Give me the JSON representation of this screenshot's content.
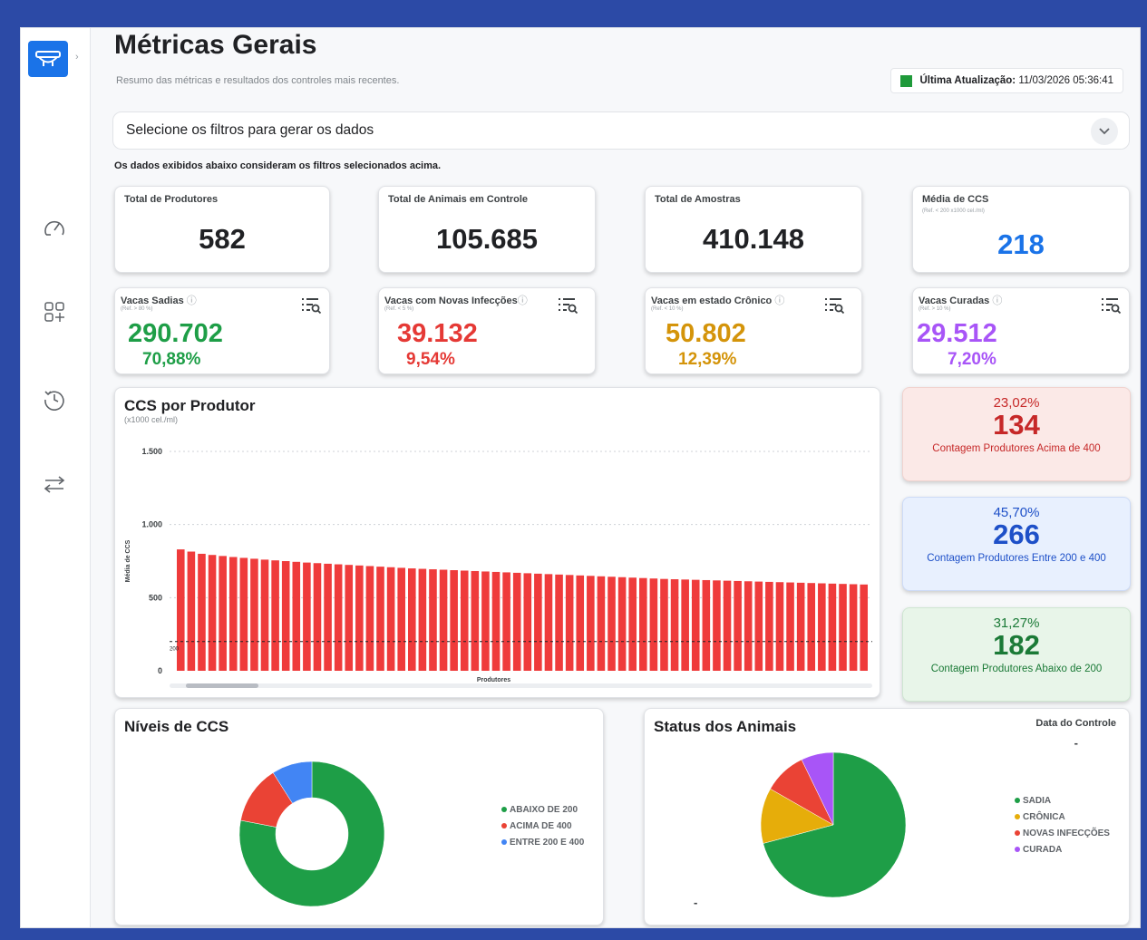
{
  "page": {
    "title": "Métricas Gerais",
    "subtitle": "Resumo das métricas e resultados dos controles mais recentes.",
    "last_update_label": "Última Atualização:",
    "last_update_value": "11/03/2026 05:36:41",
    "last_update_color": "#1f9a3a"
  },
  "filter": {
    "placeholder": "Selecione os filtros para gerar os dados",
    "note": "Os dados exibidos abaixo consideram os filtros selecionados acima."
  },
  "sidebar": {
    "items": [
      {
        "icon": "speedometer-icon"
      },
      {
        "icon": "apps-add-icon"
      },
      {
        "icon": "history-icon"
      },
      {
        "icon": "swap-arrows-icon"
      }
    ]
  },
  "kpis": [
    {
      "title": "Total de Produtores",
      "ref": "",
      "value": "582",
      "color": "#202124"
    },
    {
      "title": "Total de Animais em Controle",
      "ref": "",
      "value": "105.685",
      "color": "#202124"
    },
    {
      "title": "Total de Amostras",
      "ref": "",
      "value": "410.148",
      "color": "#202124"
    },
    {
      "title": "Média de CCS",
      "ref": "(Ref. < 200 x1000 cel./ml)",
      "value": "218",
      "color": "#1a73e8"
    }
  ],
  "health": [
    {
      "title": "Vacas Sadias",
      "ref": "(Ref. > 80 %)",
      "value": "290.702",
      "pct": "70,88%",
      "color": "#1e9e47"
    },
    {
      "title": "Vacas com Novas Infecções",
      "ref": "(Ref. < 5 %)",
      "value": "39.132",
      "pct": "9,54%",
      "color": "#e53935"
    },
    {
      "title": "Vacas em estado Crônico",
      "ref": "(Ref. < 10 %)",
      "value": "50.802",
      "pct": "12,39%",
      "color": "#d4940a"
    },
    {
      "title": "Vacas Curadas",
      "ref": "(Ref. > 10 %)",
      "value": "29.512",
      "pct": "7,20%",
      "color": "#a855f7"
    }
  ],
  "ccs_chart": {
    "title": "CCS por Produtor",
    "subtitle": "(x1000 cel./ml)",
    "ylabel": "Média de CCS",
    "xlabel": "Produtores",
    "ref_line_label": "200",
    "bar_color": "#ef3b3b"
  },
  "chart_data": {
    "type": "bar",
    "title": "CCS por Produtor",
    "xlabel": "Produtores",
    "ylabel": "Média de CCS",
    "y_ticks": [
      {
        "value": 0,
        "label": "0"
      },
      {
        "value": 500,
        "label": "500"
      },
      {
        "value": 1000,
        "label": "1.000"
      },
      {
        "value": 1500,
        "label": "1.500"
      }
    ],
    "ylim": [
      0,
      1500
    ],
    "reference_line": 200,
    "values": [
      830,
      815,
      800,
      792,
      785,
      778,
      772,
      766,
      760,
      755,
      750,
      745,
      740,
      736,
      732,
      728,
      724,
      720,
      716,
      712,
      708,
      704,
      700,
      697,
      694,
      691,
      688,
      685,
      682,
      679,
      676,
      673,
      670,
      667,
      664,
      661,
      658,
      655,
      652,
      649,
      646,
      643,
      640,
      637,
      634,
      631,
      628,
      626,
      624,
      622,
      620,
      618,
      616,
      614,
      612,
      610,
      608,
      606,
      604,
      602,
      600,
      598,
      596,
      594,
      592,
      590
    ]
  },
  "summary": [
    {
      "pct": "23,02%",
      "count": "134",
      "label": "Contagem Produtores Acima de 400",
      "color": "#c62828",
      "bg": "#fbe9e7"
    },
    {
      "pct": "45,70%",
      "count": "266",
      "label": "Contagem Produtores Entre 200 e 400",
      "color": "#1e50c8",
      "bg": "#e8f0fe"
    },
    {
      "pct": "31,27%",
      "count": "182",
      "label": "Contagem Produtores Abaixo de 200",
      "color": "#1b7a37",
      "bg": "#e8f5e9"
    }
  ],
  "ccs_levels": {
    "title": "Níveis de CCS",
    "chart_type": "donut",
    "legend": [
      {
        "label": "ABAIXO DE 200",
        "color": "#1e9e47",
        "value": 0.78
      },
      {
        "label": "ACIMA DE 400",
        "color": "#ea4335",
        "value": 0.13
      },
      {
        "label": "ENTRE 200 E 400",
        "color": "#4285f4",
        "value": 0.09
      }
    ]
  },
  "animal_status": {
    "title": "Status dos Animais",
    "control_date_label": "Data do Controle",
    "control_date_value": "-",
    "footer_mark": "-",
    "chart_type": "pie",
    "legend": [
      {
        "label": "SADIA",
        "color": "#1e9e47",
        "value": 0.7088
      },
      {
        "label": "CRÔNICA",
        "color": "#e6ad0a",
        "value": 0.1239
      },
      {
        "label": "NOVAS INFECÇÕES",
        "color": "#ea4335",
        "value": 0.0954
      },
      {
        "label": "CURADA",
        "color": "#a855f7",
        "value": 0.072
      }
    ]
  }
}
